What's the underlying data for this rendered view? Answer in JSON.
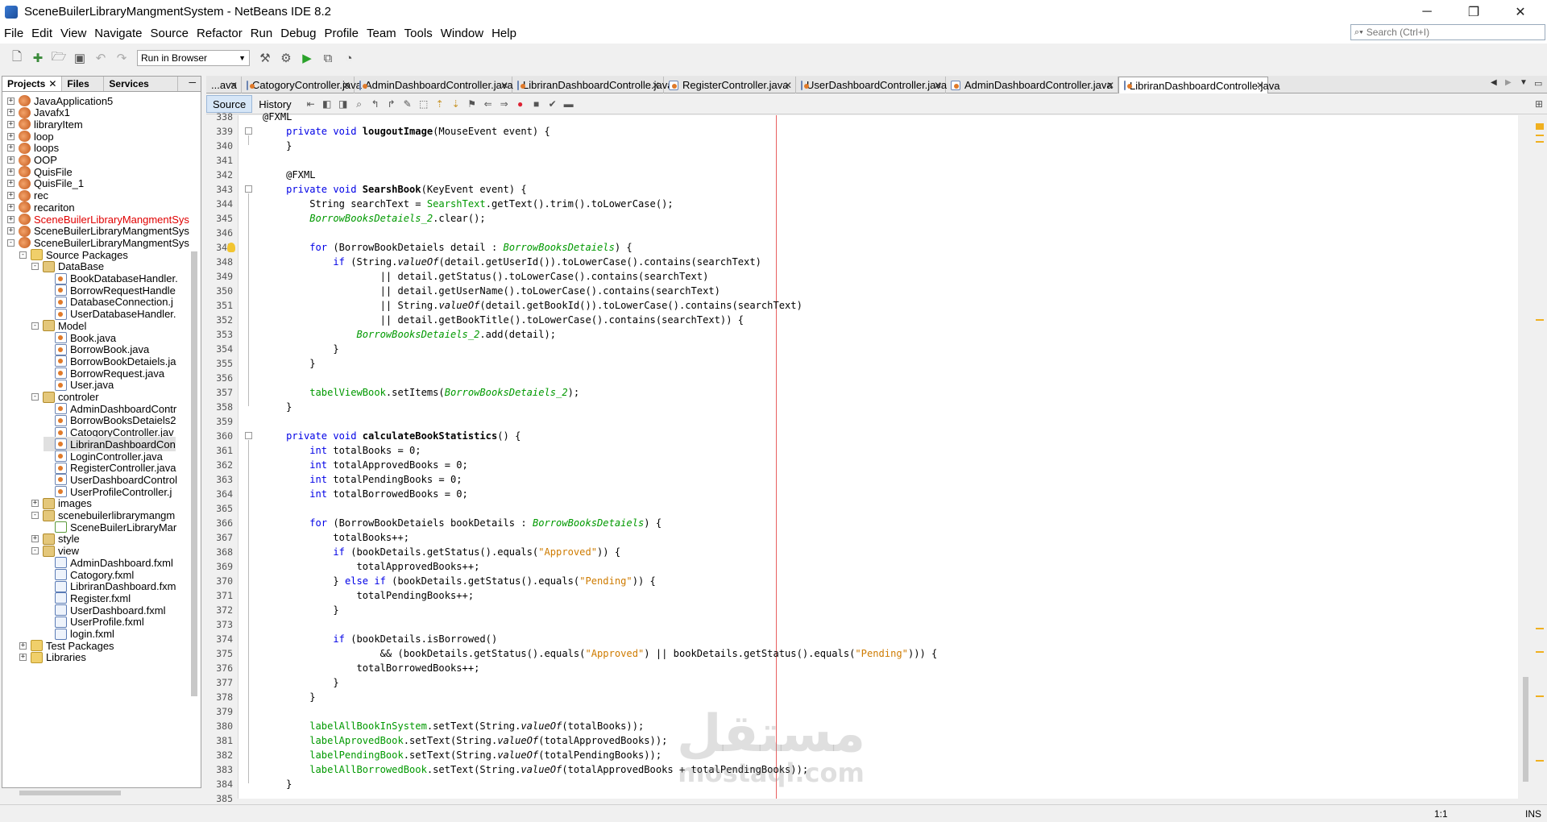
{
  "window": {
    "title": "SceneBuilerLibraryMangmentSystem - NetBeans IDE 8.2",
    "min": "─",
    "max": "❐",
    "close": "✕"
  },
  "menu": [
    "File",
    "Edit",
    "View",
    "Navigate",
    "Source",
    "Refactor",
    "Run",
    "Debug",
    "Profile",
    "Team",
    "Tools",
    "Window",
    "Help"
  ],
  "search": {
    "placeholder": "Search (Ctrl+I)",
    "icon": "magnifier-icon"
  },
  "toolbar": {
    "config": "Run in Browser"
  },
  "left_tabs": [
    "Projects",
    "Files",
    "Services"
  ],
  "tree": [
    {
      "d": 0,
      "e": "+",
      "i": "project",
      "t": "JavaApplication5"
    },
    {
      "d": 0,
      "e": "+",
      "i": "project",
      "t": "Javafx1"
    },
    {
      "d": 0,
      "e": "+",
      "i": "project",
      "t": "libraryItem"
    },
    {
      "d": 0,
      "e": "+",
      "i": "project",
      "t": "loop"
    },
    {
      "d": 0,
      "e": "+",
      "i": "project",
      "t": "loops"
    },
    {
      "d": 0,
      "e": "+",
      "i": "project",
      "t": "OOP"
    },
    {
      "d": 0,
      "e": "+",
      "i": "project",
      "t": "QuisFile"
    },
    {
      "d": 0,
      "e": "+",
      "i": "project",
      "t": "QuisFile_1"
    },
    {
      "d": 0,
      "e": "+",
      "i": "project",
      "t": "rec"
    },
    {
      "d": 0,
      "e": "+",
      "i": "project",
      "t": "recariton"
    },
    {
      "d": 0,
      "e": "+",
      "i": "project",
      "t": "SceneBuilerLibraryMangmentSys",
      "red": true
    },
    {
      "d": 0,
      "e": "+",
      "i": "project",
      "t": "SceneBuilerLibraryMangmentSys"
    },
    {
      "d": 0,
      "e": "-",
      "i": "project",
      "t": "SceneBuilerLibraryMangmentSys"
    },
    {
      "d": 1,
      "e": "-",
      "i": "folder",
      "t": "Source Packages"
    },
    {
      "d": 2,
      "e": "-",
      "i": "package",
      "t": "DataBase"
    },
    {
      "d": 3,
      "e": "",
      "i": "java",
      "t": "BookDatabaseHandler."
    },
    {
      "d": 3,
      "e": "",
      "i": "java",
      "t": "BorrowRequestHandle"
    },
    {
      "d": 3,
      "e": "",
      "i": "java",
      "t": "DatabaseConnection.j"
    },
    {
      "d": 3,
      "e": "",
      "i": "java",
      "t": "UserDatabaseHandler."
    },
    {
      "d": 2,
      "e": "-",
      "i": "package",
      "t": "Model"
    },
    {
      "d": 3,
      "e": "",
      "i": "java",
      "t": "Book.java"
    },
    {
      "d": 3,
      "e": "",
      "i": "java",
      "t": "BorrowBook.java"
    },
    {
      "d": 3,
      "e": "",
      "i": "java",
      "t": "BorrowBookDetaiels.ja"
    },
    {
      "d": 3,
      "e": "",
      "i": "java",
      "t": "BorrowRequest.java"
    },
    {
      "d": 3,
      "e": "",
      "i": "java",
      "t": "User.java"
    },
    {
      "d": 2,
      "e": "-",
      "i": "package",
      "t": "controler"
    },
    {
      "d": 3,
      "e": "",
      "i": "java",
      "t": "AdminDashboardContr"
    },
    {
      "d": 3,
      "e": "",
      "i": "java",
      "t": "BorrowBooksDetaiels2"
    },
    {
      "d": 3,
      "e": "",
      "i": "java",
      "t": "CatogoryController.jav"
    },
    {
      "d": 3,
      "e": "",
      "i": "java",
      "t": "LibriranDashboardCon",
      "sel": true
    },
    {
      "d": 3,
      "e": "",
      "i": "java",
      "t": "LoginController.java"
    },
    {
      "d": 3,
      "e": "",
      "i": "java",
      "t": "RegisterController.java"
    },
    {
      "d": 3,
      "e": "",
      "i": "java",
      "t": "UserDashboardControl"
    },
    {
      "d": 3,
      "e": "",
      "i": "java",
      "t": "UserProfileController.j"
    },
    {
      "d": 2,
      "e": "+",
      "i": "package",
      "t": "images"
    },
    {
      "d": 2,
      "e": "-",
      "i": "package",
      "t": "scenebuilerlibrarymangm"
    },
    {
      "d": 3,
      "e": "",
      "i": "main",
      "t": "SceneBuilerLibraryMar"
    },
    {
      "d": 2,
      "e": "+",
      "i": "package",
      "t": "style"
    },
    {
      "d": 2,
      "e": "-",
      "i": "package",
      "t": "view"
    },
    {
      "d": 3,
      "e": "",
      "i": "fxml",
      "t": "AdminDashboard.fxml"
    },
    {
      "d": 3,
      "e": "",
      "i": "fxml",
      "t": "Catogory.fxml"
    },
    {
      "d": 3,
      "e": "",
      "i": "fxml",
      "t": "LibriranDashboard.fxm"
    },
    {
      "d": 3,
      "e": "",
      "i": "fxml",
      "t": "Register.fxml"
    },
    {
      "d": 3,
      "e": "",
      "i": "fxml",
      "t": "UserDashboard.fxml"
    },
    {
      "d": 3,
      "e": "",
      "i": "fxml",
      "t": "UserProfile.fxml"
    },
    {
      "d": 3,
      "e": "",
      "i": "fxml",
      "t": "login.fxml"
    },
    {
      "d": 1,
      "e": "+",
      "i": "folder",
      "t": "Test Packages"
    },
    {
      "d": 1,
      "e": "+",
      "i": "folder",
      "t": "Libraries"
    }
  ],
  "editor_tabs": [
    "...ava",
    "CatogoryController.java",
    "AdminDashboardController.java",
    "LibriranDashboardControlle.java",
    "RegisterController.java",
    "UserDashboardController.java",
    "AdminDashboardController.java",
    "LibriranDashboardControlle.java"
  ],
  "active_tab": 7,
  "source_tabs": [
    "Source",
    "History"
  ],
  "code_lines": [
    [
      338,
      [
        [
          "@FXML",
          "ann"
        ]
      ]
    ],
    [
      339,
      [
        [
          "    "
        ],
        [
          "private",
          "kw"
        ],
        [
          " "
        ],
        [
          "void",
          "kw"
        ],
        [
          " "
        ],
        [
          "lougoutImage",
          "mb"
        ],
        [
          "(MouseEvent event) {"
        ]
      ]
    ],
    [
      340,
      [
        [
          "    }"
        ]
      ]
    ],
    [
      341,
      [
        [
          ""
        ]
      ]
    ],
    [
      342,
      [
        [
          "    @FXML"
        ]
      ]
    ],
    [
      343,
      [
        [
          "    "
        ],
        [
          "private",
          "kw"
        ],
        [
          " "
        ],
        [
          "void",
          "kw"
        ],
        [
          " "
        ],
        [
          "SearshBook",
          "mb"
        ],
        [
          "(KeyEvent event) {"
        ]
      ]
    ],
    [
      344,
      [
        [
          "        String searchText = "
        ],
        [
          "SearshText",
          "fld"
        ],
        [
          ".getText().trim().toLowerCase();"
        ]
      ]
    ],
    [
      345,
      [
        [
          "        "
        ],
        [
          "BorrowBooksDetaiels_2",
          "sfld"
        ],
        [
          ".clear();"
        ]
      ]
    ],
    [
      346,
      [
        [
          ""
        ]
      ]
    ],
    [
      347,
      [
        [
          "        "
        ],
        [
          "for",
          "kw"
        ],
        [
          " (BorrowBookDetaiels detail : "
        ],
        [
          "BorrowBooksDetaiels",
          "sfld"
        ],
        [
          ") {"
        ]
      ]
    ],
    [
      348,
      [
        [
          "            "
        ],
        [
          "if",
          "kw"
        ],
        [
          " (String."
        ],
        [
          "valueOf",
          "st"
        ],
        [
          "(detail.getUserId()).toLowerCase().contains(searchText)"
        ]
      ]
    ],
    [
      349,
      [
        [
          "                    || detail.getStatus().toLowerCase().contains(searchText)"
        ]
      ]
    ],
    [
      350,
      [
        [
          "                    || detail.getUserName().toLowerCase().contains(searchText)"
        ]
      ]
    ],
    [
      351,
      [
        [
          "                    || String."
        ],
        [
          "valueOf",
          "st"
        ],
        [
          "(detail.getBookId()).toLowerCase().contains(searchText)"
        ]
      ]
    ],
    [
      352,
      [
        [
          "                    || detail.getBookTitle().toLowerCase().contains(searchText)) {"
        ]
      ]
    ],
    [
      353,
      [
        [
          "                "
        ],
        [
          "BorrowBooksDetaiels_2",
          "sfld"
        ],
        [
          ".add(detail);"
        ]
      ]
    ],
    [
      354,
      [
        [
          "            }"
        ]
      ]
    ],
    [
      355,
      [
        [
          "        }"
        ]
      ]
    ],
    [
      356,
      [
        [
          ""
        ]
      ]
    ],
    [
      357,
      [
        [
          "        "
        ],
        [
          "tabelViewBook",
          "fld"
        ],
        [
          ".setItems("
        ],
        [
          "BorrowBooksDetaiels_2",
          "sfld"
        ],
        [
          ");"
        ]
      ]
    ],
    [
      358,
      [
        [
          "    }"
        ]
      ]
    ],
    [
      359,
      [
        [
          ""
        ]
      ]
    ],
    [
      360,
      [
        [
          "    "
        ],
        [
          "private",
          "kw"
        ],
        [
          " "
        ],
        [
          "void",
          "kw"
        ],
        [
          " "
        ],
        [
          "calculateBookStatistics",
          "mb"
        ],
        [
          "() {"
        ]
      ]
    ],
    [
      361,
      [
        [
          "        "
        ],
        [
          "int",
          "kw"
        ],
        [
          " totalBooks = 0;"
        ]
      ]
    ],
    [
      362,
      [
        [
          "        "
        ],
        [
          "int",
          "kw"
        ],
        [
          " totalApprovedBooks = 0;"
        ]
      ]
    ],
    [
      363,
      [
        [
          "        "
        ],
        [
          "int",
          "kw"
        ],
        [
          " totalPendingBooks = 0;"
        ]
      ]
    ],
    [
      364,
      [
        [
          "        "
        ],
        [
          "int",
          "kw"
        ],
        [
          " totalBorrowedBooks = 0;"
        ]
      ]
    ],
    [
      365,
      [
        [
          ""
        ]
      ]
    ],
    [
      366,
      [
        [
          "        "
        ],
        [
          "for",
          "kw"
        ],
        [
          " (BorrowBookDetaiels bookDetails : "
        ],
        [
          "BorrowBooksDetaiels",
          "sfld"
        ],
        [
          ") {"
        ]
      ]
    ],
    [
      367,
      [
        [
          "            totalBooks++;"
        ]
      ]
    ],
    [
      368,
      [
        [
          "            "
        ],
        [
          "if",
          "kw"
        ],
        [
          " (bookDetails.getStatus().equals("
        ],
        [
          "\"Approved\"",
          "str"
        ],
        [
          ")) {"
        ]
      ]
    ],
    [
      369,
      [
        [
          "                totalApprovedBooks++;"
        ]
      ]
    ],
    [
      370,
      [
        [
          "            } "
        ],
        [
          "else",
          "kw"
        ],
        [
          " "
        ],
        [
          "if",
          "kw"
        ],
        [
          " (bookDetails.getStatus().equals("
        ],
        [
          "\"Pending\"",
          "str"
        ],
        [
          ")) {"
        ]
      ]
    ],
    [
      371,
      [
        [
          "                totalPendingBooks++;"
        ]
      ]
    ],
    [
      372,
      [
        [
          "            }"
        ]
      ]
    ],
    [
      373,
      [
        [
          ""
        ]
      ]
    ],
    [
      374,
      [
        [
          "            "
        ],
        [
          "if",
          "kw"
        ],
        [
          " (bookDetails.isBorrowed()"
        ]
      ]
    ],
    [
      375,
      [
        [
          "                    && (bookDetails.getStatus().equals("
        ],
        [
          "\"Approved\"",
          "str"
        ],
        [
          ") || bookDetails.getStatus().equals("
        ],
        [
          "\"Pending\"",
          "str"
        ],
        [
          "))) {"
        ]
      ]
    ],
    [
      376,
      [
        [
          "                totalBorrowedBooks++;"
        ]
      ]
    ],
    [
      377,
      [
        [
          "            }"
        ]
      ]
    ],
    [
      378,
      [
        [
          "        }"
        ]
      ]
    ],
    [
      379,
      [
        [
          ""
        ]
      ]
    ],
    [
      380,
      [
        [
          "        "
        ],
        [
          "labelAllBookInSystem",
          "fld"
        ],
        [
          ".setText(String."
        ],
        [
          "valueOf",
          "st"
        ],
        [
          "(totalBooks));"
        ]
      ]
    ],
    [
      381,
      [
        [
          "        "
        ],
        [
          "labelAprovedBook",
          "fld"
        ],
        [
          ".setText(String."
        ],
        [
          "valueOf",
          "st"
        ],
        [
          "(totalApprovedBooks));"
        ]
      ]
    ],
    [
      382,
      [
        [
          "        "
        ],
        [
          "labelPendingBook",
          "fld"
        ],
        [
          ".setText(String."
        ],
        [
          "valueOf",
          "st"
        ],
        [
          "(totalPendingBooks));"
        ]
      ]
    ],
    [
      383,
      [
        [
          "        "
        ],
        [
          "labelAllBorrowedBook",
          "fld"
        ],
        [
          ".setText(String."
        ],
        [
          "valueOf",
          "st"
        ],
        [
          "(totalApprovedBooks + totalPendingBooks));"
        ]
      ]
    ],
    [
      384,
      [
        [
          "    }"
        ]
      ]
    ],
    [
      385,
      [
        [
          ""
        ]
      ]
    ]
  ],
  "watermark": {
    "arabic": "مستقل",
    "latin": "mostaql.com"
  },
  "status": {
    "position": "1:1",
    "mode": "INS"
  }
}
